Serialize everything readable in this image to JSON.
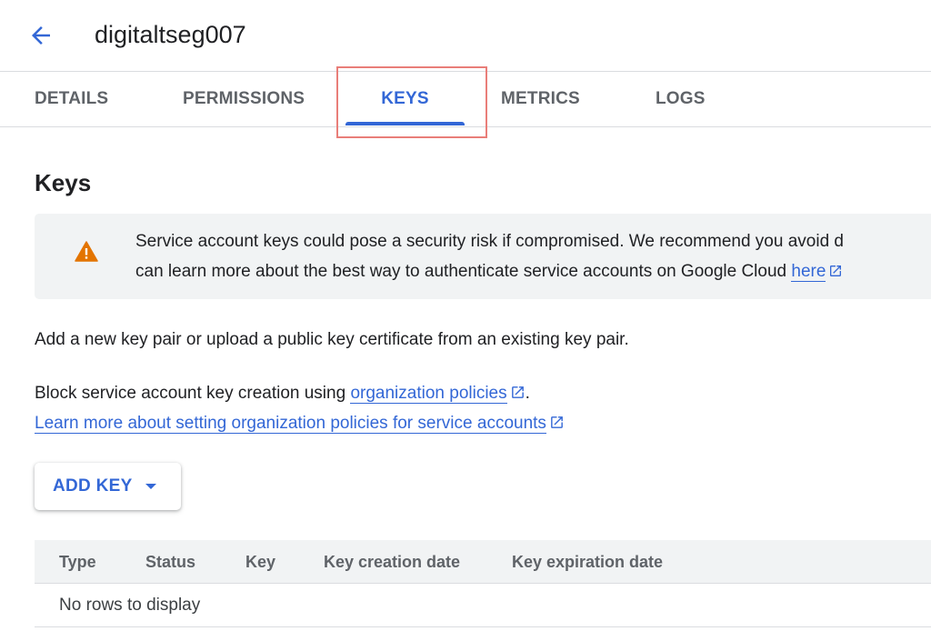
{
  "header": {
    "title": "digitaltseg007",
    "back_icon": "arrow-back-icon"
  },
  "tabs": [
    {
      "label": "DETAILS",
      "active": false
    },
    {
      "label": "PERMISSIONS",
      "active": false
    },
    {
      "label": "KEYS",
      "active": true
    },
    {
      "label": "METRICS",
      "active": false
    },
    {
      "label": "LOGS",
      "active": false
    }
  ],
  "keys": {
    "title": "Keys",
    "warning": {
      "icon": "warning-icon",
      "line1": "Service account keys could pose a security risk if compromised. We recommend you avoid d",
      "line2_text": "can learn more about the best way to authenticate service accounts on Google Cloud ",
      "line2_link": "here"
    },
    "intro": "Add a new key pair or upload a public key certificate from an existing key pair.",
    "block_text": "Block service account key creation using ",
    "block_link": "organization policies",
    "block_end": ".",
    "learn_more_link": "Learn more about setting organization policies for service accounts",
    "add_key_label": "ADD KEY"
  },
  "table": {
    "columns": [
      "Type",
      "Status",
      "Key",
      "Key creation date",
      "Key expiration date"
    ],
    "empty_message": "No rows to display"
  },
  "colors": {
    "accent": "#3367d6",
    "warning": "#e37400",
    "highlight": "#e97e79"
  }
}
